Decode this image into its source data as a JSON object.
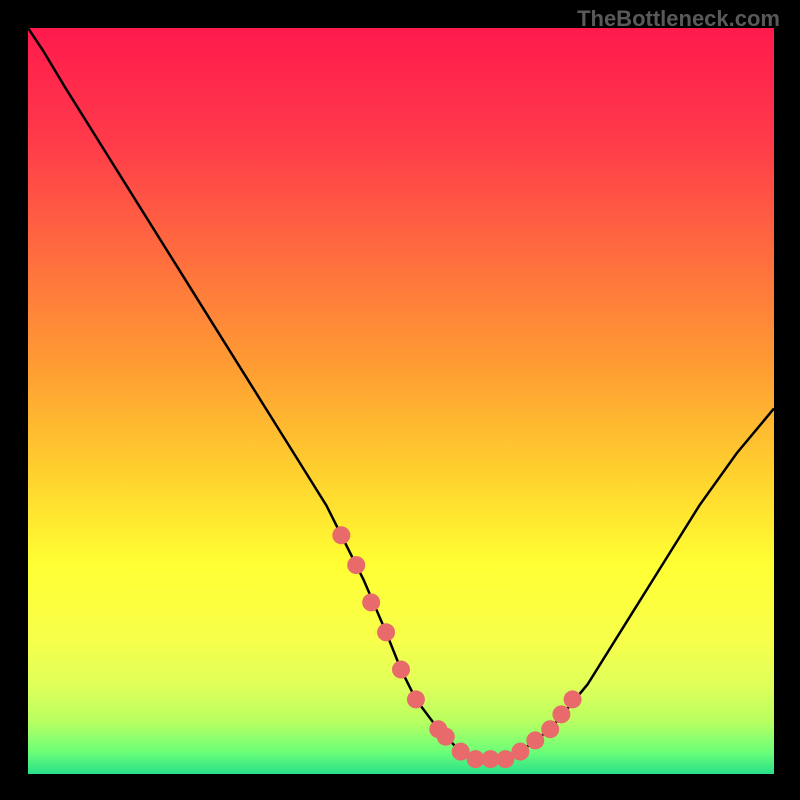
{
  "watermark": "TheBottleneck.com",
  "chart_data": {
    "type": "line",
    "title": "",
    "xlabel": "",
    "ylabel": "",
    "xlim": [
      0,
      100
    ],
    "ylim": [
      0,
      100
    ],
    "x": [
      0,
      2,
      5,
      10,
      15,
      20,
      25,
      30,
      35,
      40,
      42,
      45,
      48,
      50,
      52,
      55,
      58,
      60,
      62,
      64,
      66,
      70,
      75,
      80,
      85,
      90,
      95,
      100
    ],
    "values": [
      100,
      97,
      92,
      84,
      76,
      68,
      60,
      52,
      44,
      36,
      32,
      26,
      19,
      14,
      10,
      6,
      3,
      2,
      2,
      2,
      3,
      6,
      12,
      20,
      28,
      36,
      43,
      49
    ],
    "markers_x": [
      42,
      44,
      46,
      48,
      50,
      52,
      55,
      56,
      58,
      60,
      62,
      64,
      66,
      68,
      70,
      71.5,
      73
    ],
    "markers_y": [
      32,
      28,
      23,
      19,
      14,
      10,
      6,
      5,
      3,
      2,
      2,
      2,
      3,
      4.5,
      6,
      8,
      10
    ],
    "gradient_stops": [
      {
        "offset": 0.0,
        "color": "#ff1a4d"
      },
      {
        "offset": 0.15,
        "color": "#ff3a4a"
      },
      {
        "offset": 0.3,
        "color": "#ff6b3f"
      },
      {
        "offset": 0.45,
        "color": "#ff9b33"
      },
      {
        "offset": 0.6,
        "color": "#ffd22e"
      },
      {
        "offset": 0.72,
        "color": "#ffff33"
      },
      {
        "offset": 0.82,
        "color": "#f7ff4a"
      },
      {
        "offset": 0.88,
        "color": "#e0ff5a"
      },
      {
        "offset": 0.93,
        "color": "#b8ff60"
      },
      {
        "offset": 0.97,
        "color": "#6cff78"
      },
      {
        "offset": 1.0,
        "color": "#28e08a"
      }
    ],
    "marker_color": "#e86a6a",
    "curve_color": "#000000"
  }
}
